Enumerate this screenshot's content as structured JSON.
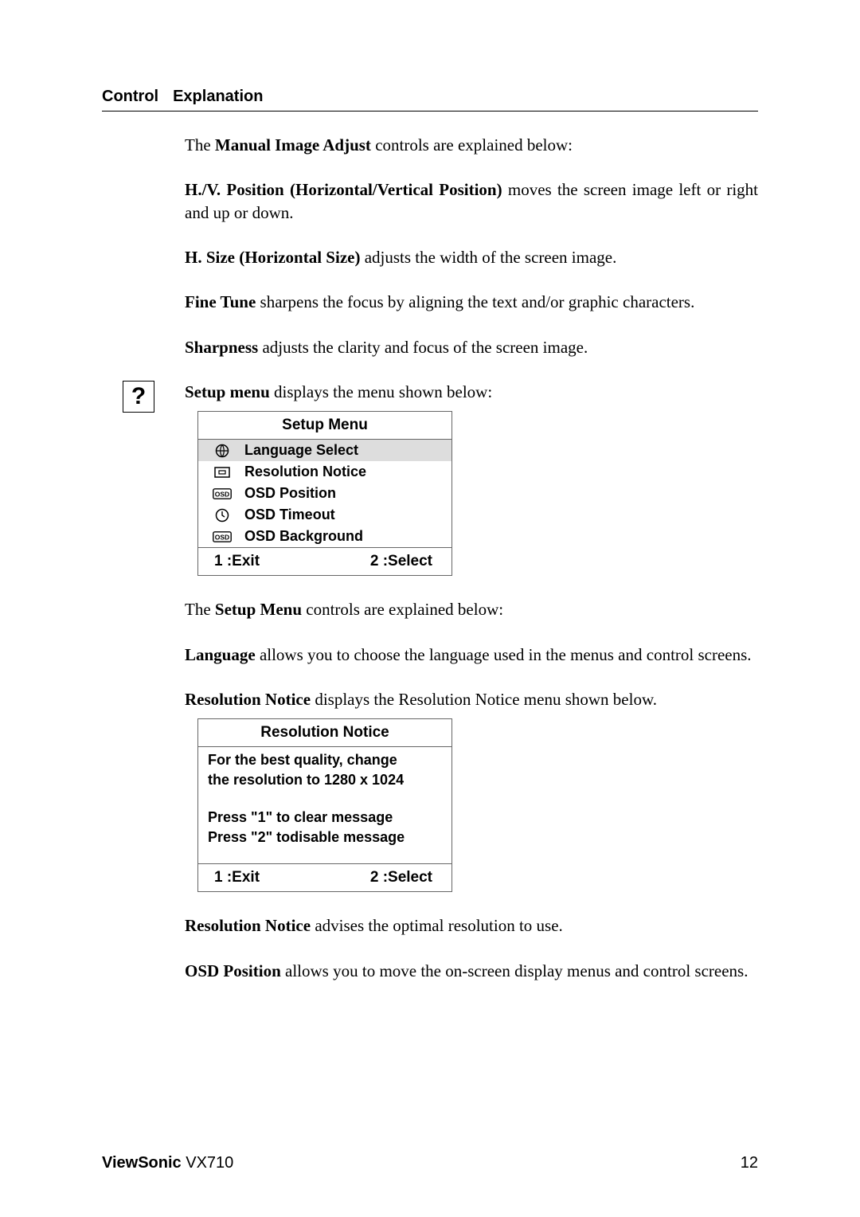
{
  "header": {
    "col1": "Control",
    "col2": "Explanation"
  },
  "p1_lead": "The ",
  "p1_bold": "Manual Image Adjust",
  "p1_tail": " controls are explained below:",
  "p2_bold": "H./V. Position (Horizontal/Vertical Position)",
  "p2_tail": " moves the screen image left or right and up or down.",
  "p3_bold": "H. Size (Horizontal Size)",
  "p3_tail": " adjusts the width of the screen image.",
  "p4_bold": "Fine Tune",
  "p4_tail": " sharpens the focus by aligning the text and/or graphic characters.",
  "p5_bold": "Sharpness",
  "p5_tail": " adjusts the clarity and focus of the screen image.",
  "p6_bold": "Setup menu",
  "p6_tail": " displays the menu shown below:",
  "icon_question": "?",
  "setup_menu": {
    "title": "Setup Menu",
    "items": [
      {
        "icon": "globe",
        "label": "Language Select",
        "selected": true
      },
      {
        "icon": "screen",
        "label": "Resolution Notice",
        "selected": false
      },
      {
        "icon": "osd",
        "label": "OSD Position",
        "selected": false
      },
      {
        "icon": "clock",
        "label": "OSD Timeout",
        "selected": false
      },
      {
        "icon": "osd",
        "label": "OSD Background",
        "selected": false
      }
    ],
    "footer_left": "1 :Exit",
    "footer_right": "2 :Select"
  },
  "p7_lead": "The ",
  "p7_bold": "Setup Menu",
  "p7_tail": " controls are explained below:",
  "p8_bold": "Language",
  "p8_tail": " allows you to choose the language used in the menus and control screens.",
  "p9_bold": "Resolution Notice",
  "p9_tail": " displays the Resolution Notice menu shown below.",
  "res_notice": {
    "title": "Resolution Notice",
    "line1": "For the best quality, change",
    "line2": "the resolution to 1280 x 1024",
    "line3": "Press \"1\" to clear message",
    "line4": "Press \"2\" todisable message",
    "footer_left": "1 :Exit",
    "footer_right": "2 :Select"
  },
  "p10_bold": "Resolution Notice",
  "p10_tail": " advises the optimal resolution to use.",
  "p11_bold": "OSD Position",
  "p11_tail": " allows you to move the on-screen display menus and control screens.",
  "footer": {
    "brand": "ViewSonic",
    "model": "  VX710",
    "page": "12"
  }
}
